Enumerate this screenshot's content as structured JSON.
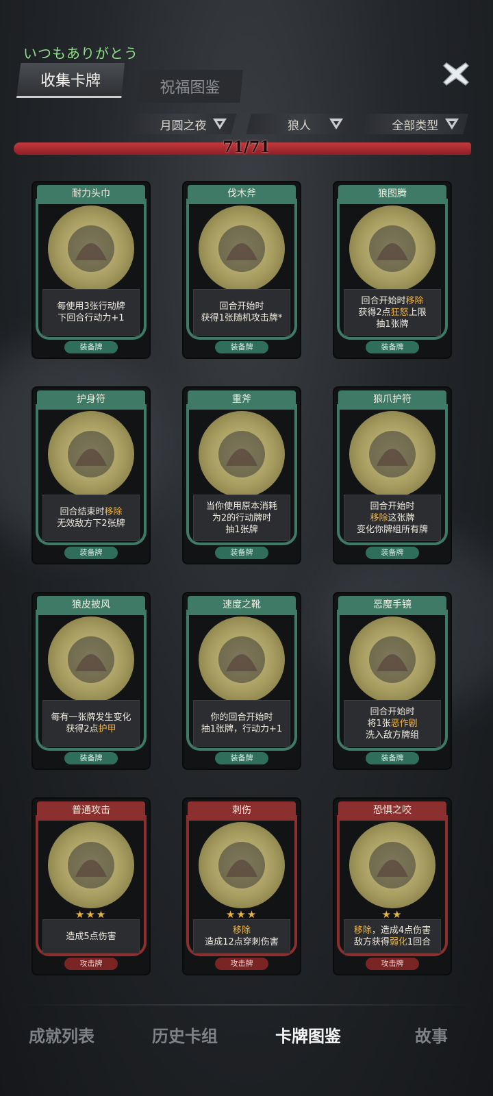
{
  "header": {
    "greeting": "いつもありがとう",
    "tabs": [
      {
        "label": "收集卡牌",
        "active": true
      },
      {
        "label": "祝福图鉴",
        "active": false
      }
    ]
  },
  "filters": [
    {
      "label": "月圆之夜",
      "icon": "chevron-down-icon"
    },
    {
      "label": "狼人",
      "icon": "chevron-down-icon"
    },
    {
      "label": "全部类型",
      "icon": "chevron-down-icon"
    }
  ],
  "progress": {
    "text": "71/71",
    "value": 1.0
  },
  "cards": [
    {
      "name": "耐力头巾",
      "lines": [
        "每使用3张行动牌",
        "下回合行动力+1"
      ],
      "type": "装备牌",
      "color": "green",
      "icon": "bandana-icon"
    },
    {
      "name": "伐木斧",
      "lines": [
        "回合开始时",
        "获得1张随机攻击牌*"
      ],
      "type": "装备牌",
      "color": "green",
      "icon": "axe-icon"
    },
    {
      "name": "狼图腾",
      "lines": [
        "回合开始时移除",
        "获得2点狂怒上限",
        "抽1张牌"
      ],
      "type": "装备牌",
      "color": "green",
      "icon": "wolf-totem-icon"
    },
    {
      "name": "护身符",
      "lines": [
        "回合结束时移除",
        "无效敌方下2张牌"
      ],
      "type": "装备牌",
      "color": "green",
      "icon": "amulet-icon"
    },
    {
      "name": "重斧",
      "lines": [
        "当你使用原本消耗",
        "为2的行动牌时",
        "抽1张牌"
      ],
      "type": "装备牌",
      "color": "green",
      "icon": "heavy-axe-icon"
    },
    {
      "name": "狼爪护符",
      "lines": [
        "回合开始时",
        "移除这张牌",
        "变化你牌组所有牌"
      ],
      "type": "装备牌",
      "color": "green",
      "icon": "claw-charm-icon"
    },
    {
      "name": "狼皮披风",
      "lines": [
        "每有一张牌发生变化",
        "获得2点护甲"
      ],
      "type": "装备牌",
      "color": "green",
      "icon": "cloak-icon"
    },
    {
      "name": "速度之靴",
      "lines": [
        "你的回合开始时",
        "抽1张牌，行动力+1"
      ],
      "type": "装备牌",
      "color": "green",
      "icon": "boot-icon"
    },
    {
      "name": "恶魔手镜",
      "lines": [
        "回合开始时",
        "将1张恶作剧",
        "洗入敌方牌组"
      ],
      "type": "装备牌",
      "color": "green",
      "icon": "demon-mirror-icon"
    },
    {
      "name": "普通攻击",
      "lines": [
        "造成5点伤害"
      ],
      "type": "攻击牌",
      "color": "red",
      "stars": "★★★",
      "icon": "slash-axe-icon"
    },
    {
      "name": "刺伤",
      "lines": [
        "移除",
        "造成12点穿刺伤害"
      ],
      "type": "攻击牌",
      "color": "red",
      "stars": "★★★",
      "icon": "sword-icon"
    },
    {
      "name": "恐惧之咬",
      "lines": [
        "移除，造成4点伤害",
        "敌方获得弱化1回合"
      ],
      "type": "攻击牌",
      "color": "red",
      "stars": "★★",
      "icon": "skull-bite-icon"
    }
  ],
  "bottom_nav": [
    {
      "label": "成就列表",
      "active": false
    },
    {
      "label": "历史卡组",
      "active": false
    },
    {
      "label": "卡牌图鉴",
      "active": true
    },
    {
      "label": "故事",
      "active": false
    }
  ],
  "colors": {
    "green_frame": "#3f7a66",
    "red_frame": "#8c2f2f",
    "highlight": "#f2b33d",
    "progress": "#c23a3e"
  }
}
